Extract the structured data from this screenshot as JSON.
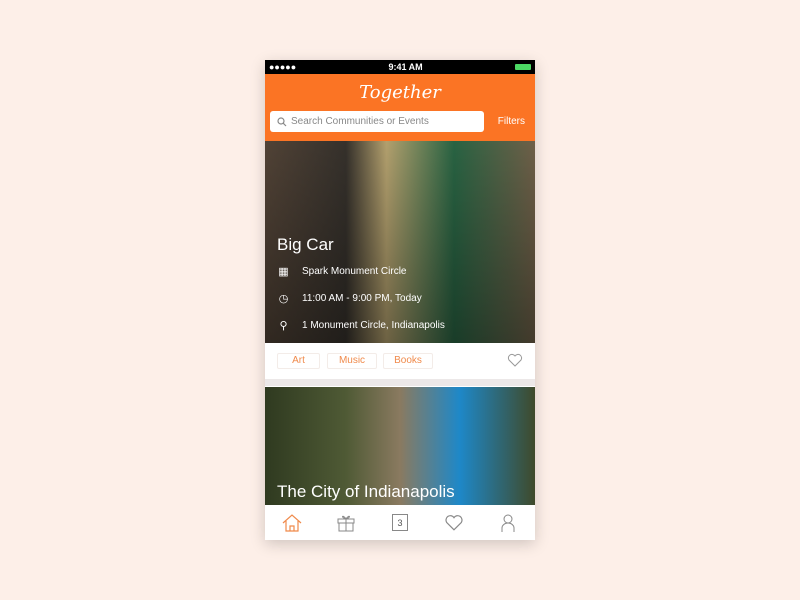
{
  "status": {
    "time": "9:41 AM",
    "signal": "●●●●●"
  },
  "header": {
    "title": "Together",
    "search_placeholder": "Search Communities or Events",
    "filters_label": "Filters"
  },
  "cards": [
    {
      "name": "Big Car",
      "venue": "Spark Monument Circle",
      "time": "11:00 AM - 9:00 PM, Today",
      "address": "1 Monument Circle, Indianapolis",
      "tags": [
        "Art",
        "Music",
        "Books"
      ]
    },
    {
      "name": "The City of Indianapolis"
    }
  ],
  "tabbar": {
    "items": [
      "home",
      "gift",
      "calendar",
      "favorites",
      "profile"
    ],
    "calendar_day": "3",
    "active": "home"
  },
  "colors": {
    "accent": "#fb7424",
    "background": "#fdefe8"
  }
}
